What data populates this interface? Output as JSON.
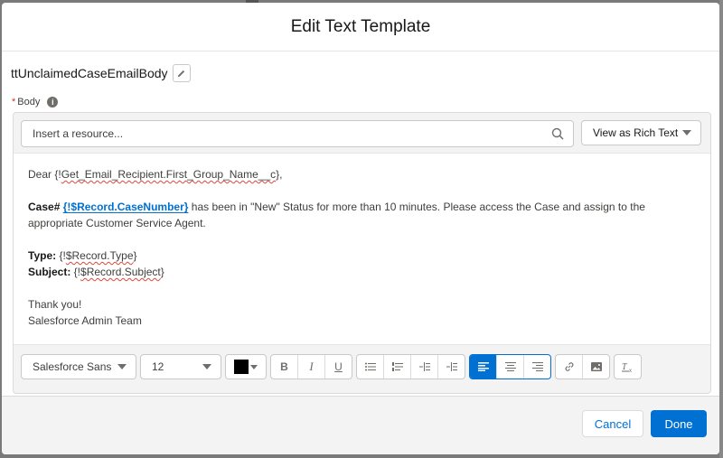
{
  "modal": {
    "title": "Edit Text Template"
  },
  "template": {
    "name": "ttUnclaimedCaseEmailBody",
    "edit_icon": "pencil-icon"
  },
  "body_field": {
    "required_marker": "*",
    "label": "Body",
    "info_icon": "info-icon"
  },
  "resource_search": {
    "placeholder": "Insert a resource...",
    "value": "",
    "icon": "search-icon"
  },
  "view_mode": {
    "selected": "View as Rich Text"
  },
  "content": {
    "greeting_prefix": "Dear {!",
    "greeting_merge": "Get_Email_Recipient.First_Group_Name__c",
    "greeting_suffix": "},",
    "case_label": "Case#",
    "case_merge_open": "{!",
    "case_merge": "$Record.CaseNumber",
    "case_merge_close": "}",
    "case_text": " has been in \"New\" Status for more than 10 minutes. Please access the Case and assign to the appropriate Customer Service Agent.",
    "type_label": "Type:",
    "type_prefix": " {!",
    "type_merge": "$Record.Type",
    "type_suffix": "}",
    "subject_label": "Subject:",
    "subject_prefix": " {!",
    "subject_merge": "$Record.Subject",
    "subject_suffix": "}",
    "closing": "Thank you!",
    "signature": "Salesforce Admin Team"
  },
  "toolbar": {
    "font_family": "Salesforce Sans",
    "font_size": "12",
    "text_color": "#000000",
    "bold": "B",
    "italic": "I",
    "underline": "U",
    "icons": [
      "bulleted-list-icon",
      "numbered-list-icon",
      "indent-icon",
      "outdent-icon",
      "align-left-icon",
      "align-center-icon",
      "align-right-icon",
      "link-icon",
      "image-icon",
      "clear-formatting-icon"
    ],
    "active_alignment": "left"
  },
  "footer": {
    "cancel_label": "Cancel",
    "done_label": "Done"
  },
  "colors": {
    "brand": "#0070d2",
    "required": "#c23934"
  }
}
